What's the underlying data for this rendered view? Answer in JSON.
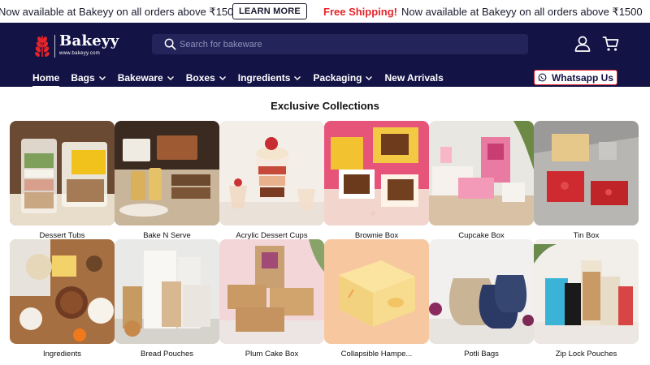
{
  "announcement": {
    "left_text": "Now available at Bakeyy on all orders above ₹1500",
    "button": "LEARN MORE",
    "highlight": "Free Shipping!",
    "right_text": "Now available at Bakeyy on all orders above ₹1500"
  },
  "brand": {
    "name": "Bakeyy",
    "url": "www.bakeyy.com"
  },
  "search": {
    "placeholder": "Search for bakeware"
  },
  "nav": {
    "items": [
      "Home",
      "Bags",
      "Bakeware",
      "Boxes",
      "Ingredients",
      "Packaging",
      "New Arrivals"
    ],
    "whatsapp": "Whatsapp Us"
  },
  "collections": {
    "title": "Exclusive Collections",
    "items": [
      "Dessert Tubs",
      "Bake N Serve",
      "Acrylic Dessert Cups",
      "Brownie Box",
      "Cupcake Box",
      "Tin Box",
      "Ingredients",
      "Bread Pouches",
      "Plum Cake Box",
      "Collapsible Hampe...",
      "Potli Bags",
      "Zip Lock Pouches"
    ]
  },
  "colors": {
    "header_bg": "#131346",
    "accent_red": "#e5242a",
    "search_bg": "#23245a"
  }
}
